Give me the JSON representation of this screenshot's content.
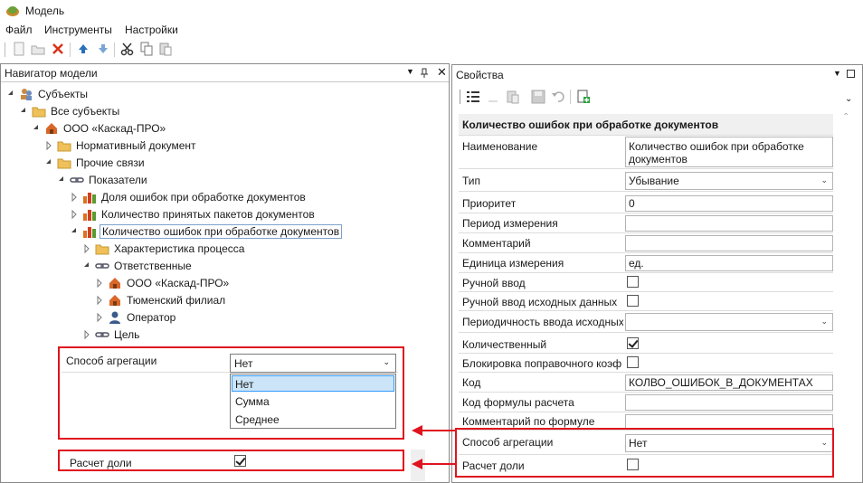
{
  "window": {
    "title": "Модель"
  },
  "menu": {
    "items": [
      "Файл",
      "Инструменты",
      "Настройки"
    ]
  },
  "navigator": {
    "title": "Навигатор модели",
    "tree": [
      "Субъекты",
      "Все субъекты",
      "ООО «Каскад-ПРО»",
      "Нормативный документ",
      "Прочие связи",
      "Показатели",
      "Доля ошибок при обработке документов",
      "Количество принятых пакетов документов",
      "Количество ошибок при обработке документов",
      "Характеристика процесса",
      "Ответственные",
      "ООО «Каскад-ПРО»",
      "Тюменский филиал",
      "Оператор",
      "Цель"
    ],
    "aggregation": {
      "label": "Способ агрегации",
      "value": "Нет",
      "options": [
        "Нет",
        "Сумма",
        "Среднее"
      ]
    },
    "share_calc": {
      "label": "Расчет доли",
      "checked": true
    }
  },
  "properties": {
    "title": "Свойства",
    "object_name": "Количество ошибок при обработке документов",
    "rows": {
      "name": {
        "label": "Наименование",
        "value_line1": "Количество ошибок при обработке",
        "value_line2": "документов"
      },
      "type": {
        "label": "Тип",
        "value": "Убывание"
      },
      "priority": {
        "label": "Приоритет",
        "value": "0"
      },
      "period": {
        "label": "Период измерения",
        "value": ""
      },
      "comment": {
        "label": "Комментарий",
        "value": ""
      },
      "unit": {
        "label": "Единица измерения",
        "value": "ед."
      },
      "manual": {
        "label": "Ручной ввод",
        "checked": false
      },
      "manual_source": {
        "label": "Ручной ввод исходных данных",
        "checked": false
      },
      "periodicity": {
        "label": "Периодичность ввода исходных",
        "value": ""
      },
      "quantitative": {
        "label": "Количественный",
        "checked": true
      },
      "lock": {
        "label": "Блокировка поправочного коэф",
        "checked": false
      },
      "code": {
        "label": "Код",
        "value": "КОЛВО_ОШИБОК_В_ДОКУМЕНТАХ"
      },
      "formula_code": {
        "label": "Код формулы расчета",
        "value": ""
      },
      "formula_comment": {
        "label": "Комментарий по формуле",
        "value": ""
      },
      "aggregation": {
        "label": "Способ агрегации",
        "value": "Нет"
      },
      "share": {
        "label": "Расчет доли",
        "checked": false
      }
    }
  },
  "colors": {
    "highlight": "#e0141e",
    "selected_option": "#cce4f7"
  }
}
